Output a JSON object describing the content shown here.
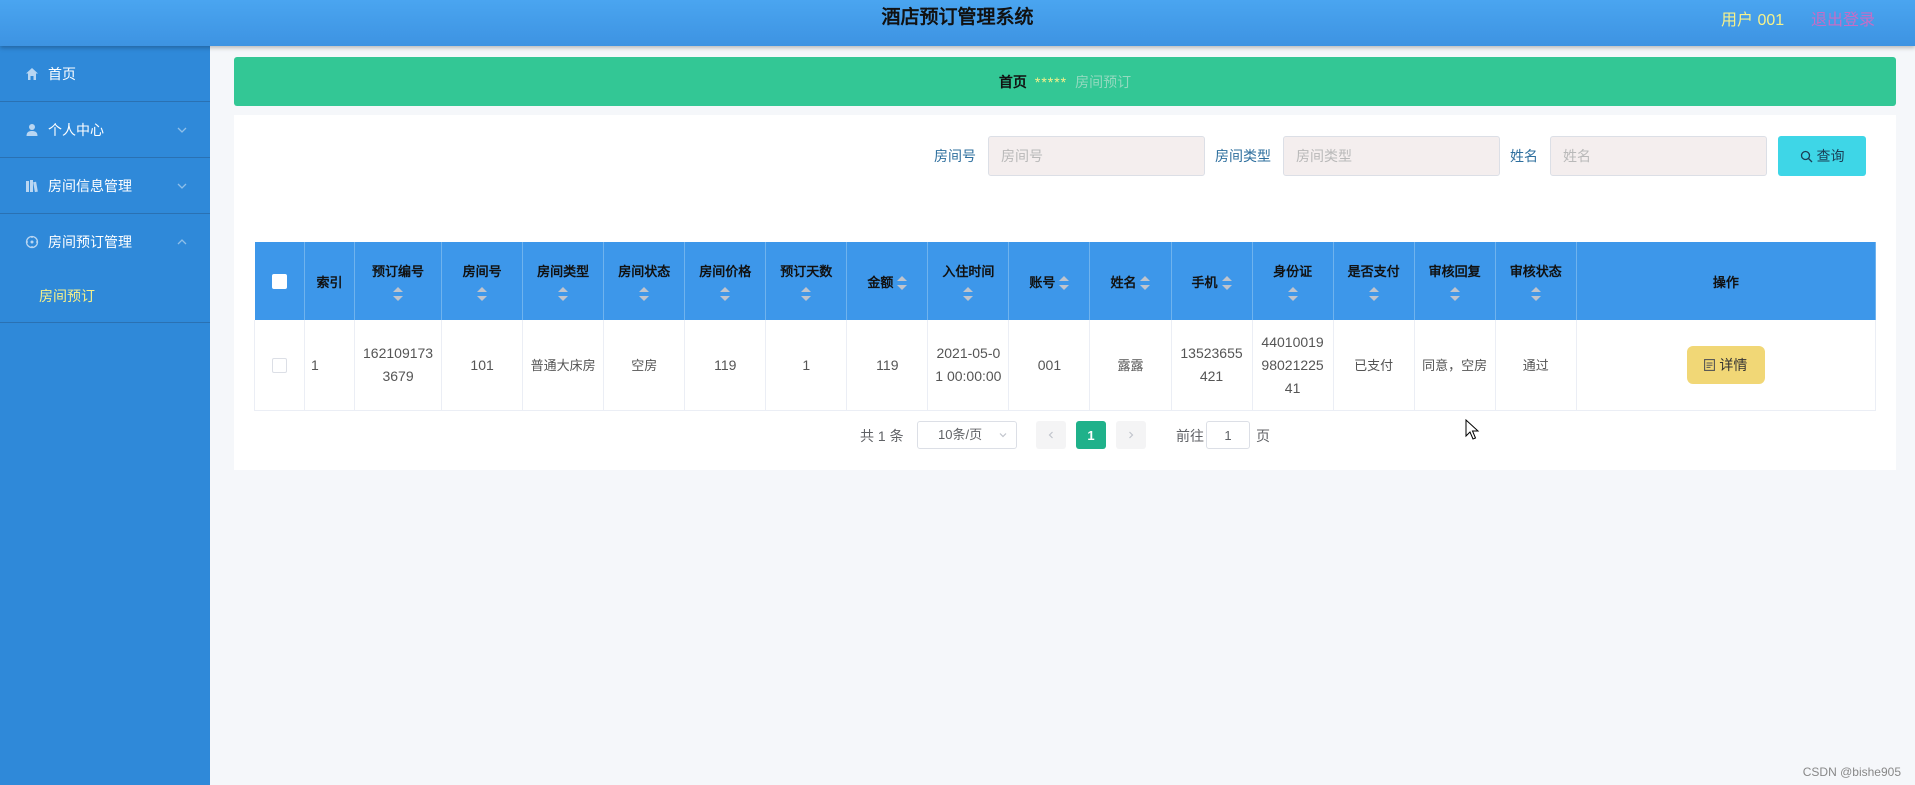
{
  "header": {
    "title": "酒店预订管理系统",
    "user": "用户 001",
    "logout": "退出登录"
  },
  "sidebar": {
    "items": [
      {
        "label": "首页",
        "icon": "home-icon"
      },
      {
        "label": "个人中心",
        "icon": "user-icon"
      },
      {
        "label": "房间信息管理",
        "icon": "books-icon"
      },
      {
        "label": "房间预订管理",
        "icon": "compass-icon"
      }
    ],
    "sub_items": [
      {
        "label": "房间预订"
      }
    ]
  },
  "breadcrumb": {
    "home": "首页",
    "separator": "*****",
    "current": "房间预订"
  },
  "search": {
    "fields": [
      {
        "label": "房间号",
        "placeholder": "房间号"
      },
      {
        "label": "房间类型",
        "placeholder": "房间类型"
      },
      {
        "label": "姓名",
        "placeholder": "姓名"
      }
    ],
    "button": "查询"
  },
  "table": {
    "columns": [
      "索引",
      "预订编号",
      "房间号",
      "房间类型",
      "房间状态",
      "房间价格",
      "预订天数",
      "金额",
      "入住时间",
      "账号",
      "姓名",
      "手机",
      "身份证",
      "是否支付",
      "审核回复",
      "审核状态",
      "操作"
    ],
    "rows": [
      {
        "index": "1",
        "booking_no": "1621091733679",
        "room_no": "101",
        "room_type": "普通大床房",
        "room_status": "空房",
        "price": "119",
        "days": "1",
        "amount": "119",
        "checkin": "2021-05-01 00:00:00",
        "account": "001",
        "name": "露露",
        "phone": "13523655421",
        "id_card": "440100199802122541",
        "paid": "已支付",
        "reply": "同意，空房",
        "audit": "通过",
        "action": "详情"
      }
    ]
  },
  "pagination": {
    "total": "共 1 条",
    "page_size": "10条/页",
    "current_page": "1",
    "goto_prefix": "前往",
    "goto_value": "1",
    "goto_suffix": "页"
  },
  "watermark": "CSDN @bishe905",
  "colors": {
    "header": "#3d93e2",
    "sidebar": "#2f89d9",
    "breadcrumb": "#33c795",
    "table_head": "#3d97ea",
    "accent_yellow": "#f7f18a",
    "page_active": "#1fb18a",
    "search_button": "#3ed6e7",
    "detail_button": "#f1d776"
  }
}
